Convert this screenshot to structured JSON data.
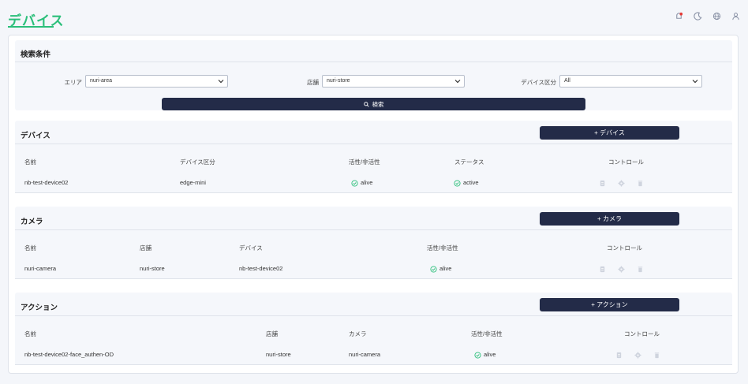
{
  "header": {
    "title": "デバイス",
    "icons": [
      "notification-icon",
      "moon-icon",
      "globe-icon",
      "user-icon"
    ]
  },
  "search": {
    "title": "検索条件",
    "area_label": "エリア",
    "area_value": "nuri-area",
    "store_label": "店舗",
    "store_value": "nuri-store",
    "device_type_label": "デバイス区分",
    "device_type_value": "All",
    "search_button": "検索"
  },
  "devices": {
    "title": "デバイス",
    "add_button": "+ デバイス",
    "columns": [
      "名前",
      "デバイス区分",
      "活性/非活性",
      "ステータス",
      "コントロール"
    ],
    "rows": [
      {
        "name": "nb-test-device02",
        "type": "edge-mini",
        "active": "alive",
        "status": "active"
      }
    ]
  },
  "cameras": {
    "title": "カメラ",
    "add_button": "+ カメラ",
    "columns": [
      "名前",
      "店舗",
      "デバイス",
      "活性/非活性",
      "コントロール"
    ],
    "rows": [
      {
        "name": "nuri-camera",
        "store": "nuri-store",
        "device": "nb-test-device02",
        "active": "alive"
      }
    ]
  },
  "actions": {
    "title": "アクション",
    "add_button": "+ アクション",
    "columns": [
      "名前",
      "店舗",
      "カメラ",
      "活性/非活性",
      "コントロール"
    ],
    "rows": [
      {
        "name": "nb-test-device02-face_authen-OD",
        "store": "nuri-store",
        "camera": "nuri-camera",
        "active": "alive"
      }
    ]
  },
  "colors": {
    "accent": "#2bbf7a",
    "button": "#232b48",
    "panel": "#f5f7fb"
  }
}
